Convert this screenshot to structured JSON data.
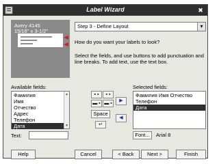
{
  "window": {
    "title": "Label Wizard",
    "close_glyph": "✖"
  },
  "preview": {
    "line1": "Avery 4145",
    "line2": "15/16\" x 3-1/2\""
  },
  "step": {
    "selected": "Step 3 - Define Layout",
    "dropdown_icon": "chevron-down-icon"
  },
  "question": "How do you want your labels to look?",
  "instructions": "Select the fields, and use buttons to add punctuation and line breaks. To add text, use the text box.",
  "available": {
    "label": "Available fields:",
    "items": [
      "Фамилия",
      "Имя",
      "Отчество",
      "Адрес",
      "Телефон",
      "Дата"
    ],
    "selected_index": 5
  },
  "selected_fields": {
    "label": "Selected fields:",
    "items": [
      "Фамилия Имя Отчество",
      "Телефон",
      "Дата"
    ],
    "selected_index": 2
  },
  "text_label": "Text:",
  "punct_buttons": [
    "▪ ▪",
    "▪ ▪",
    "▬ ▪",
    "▬ ▪"
  ],
  "space_label": "Space",
  "newline_glyph": "↵",
  "move_right_glyph": "▶",
  "move_left_glyph": "◀",
  "font": {
    "button": "Font...",
    "info": "Arial 8"
  },
  "footer": {
    "help": "Help",
    "cancel": "Cancel",
    "back": "< Back",
    "next": "Next >",
    "finish": "Finish"
  },
  "colors": {
    "title_bg": "#2f2f2f",
    "dialog_bg": "#e9e8e0",
    "selection": "#2f2f2f",
    "arrow": "#d42020"
  }
}
